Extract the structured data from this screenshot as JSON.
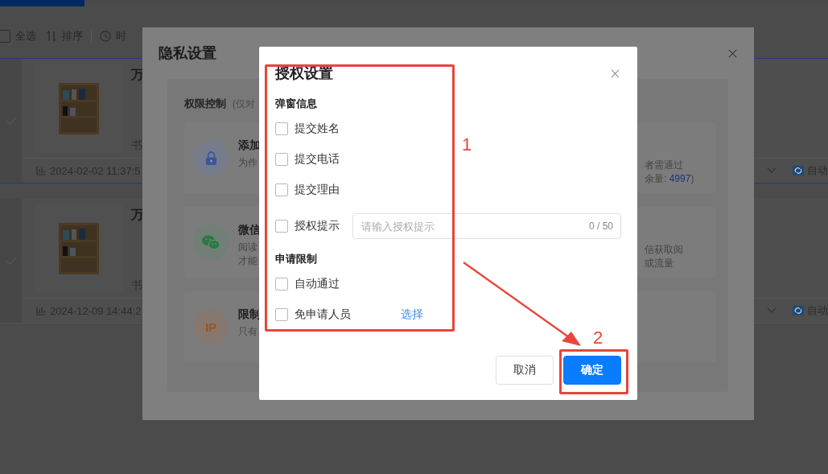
{
  "page": {
    "toolbar": {
      "select_all": {
        "label": "全选",
        "checked": false
      },
      "sort": "排序",
      "time": "时"
    },
    "rows": [
      {
        "title": "万",
        "subtitle": "书",
        "timestamp": "2024-02-02 11:37:5",
        "mode": "自动",
        "selected": true
      },
      {
        "title": "万",
        "subtitle": "书",
        "timestamp": "2024-12-09 14:44:2",
        "mode": "自动",
        "selected": false
      }
    ]
  },
  "privacy_dialog": {
    "title": "隐私设置",
    "section": "权限控制",
    "section_note": "(仅对",
    "cards": [
      {
        "kind": "lock",
        "title": "添加",
        "desc": [
          "为作"
        ],
        "right": [
          "者需通过"
        ],
        "quota": {
          "prefix": "余量: ",
          "value": "4997",
          "suffix": ")"
        }
      },
      {
        "kind": "wechat",
        "title": "微信",
        "desc": [
          "阅读",
          "才能"
        ],
        "right": [
          "信获取阅",
          "或流量"
        ]
      },
      {
        "kind": "ip",
        "icon_text": "IP",
        "title": "限制",
        "desc": [
          "只有"
        ]
      }
    ]
  },
  "auth_dialog": {
    "title": "授权设置",
    "sections": [
      {
        "label": "弹窗信息",
        "options": [
          {
            "kind": "plain",
            "label": "提交姓名",
            "checked": false
          },
          {
            "kind": "plain",
            "label": "提交电话",
            "checked": false
          },
          {
            "kind": "plain",
            "label": "提交理由",
            "checked": false
          },
          {
            "kind": "input",
            "label": "授权提示",
            "checked": false,
            "placeholder": "请输入授权提示",
            "counter": "0 / 50"
          }
        ]
      },
      {
        "label": "申请限制",
        "options": [
          {
            "kind": "plain",
            "label": "自动通过",
            "checked": false
          },
          {
            "kind": "link",
            "label": "免申请人员",
            "checked": false,
            "link": "选择"
          }
        ]
      }
    ],
    "buttons": [
      {
        "kind": "default",
        "label": "取消"
      },
      {
        "kind": "primary",
        "label": "确定"
      }
    ]
  },
  "annotations": [
    {
      "label": "1"
    },
    {
      "label": "2"
    }
  ]
}
